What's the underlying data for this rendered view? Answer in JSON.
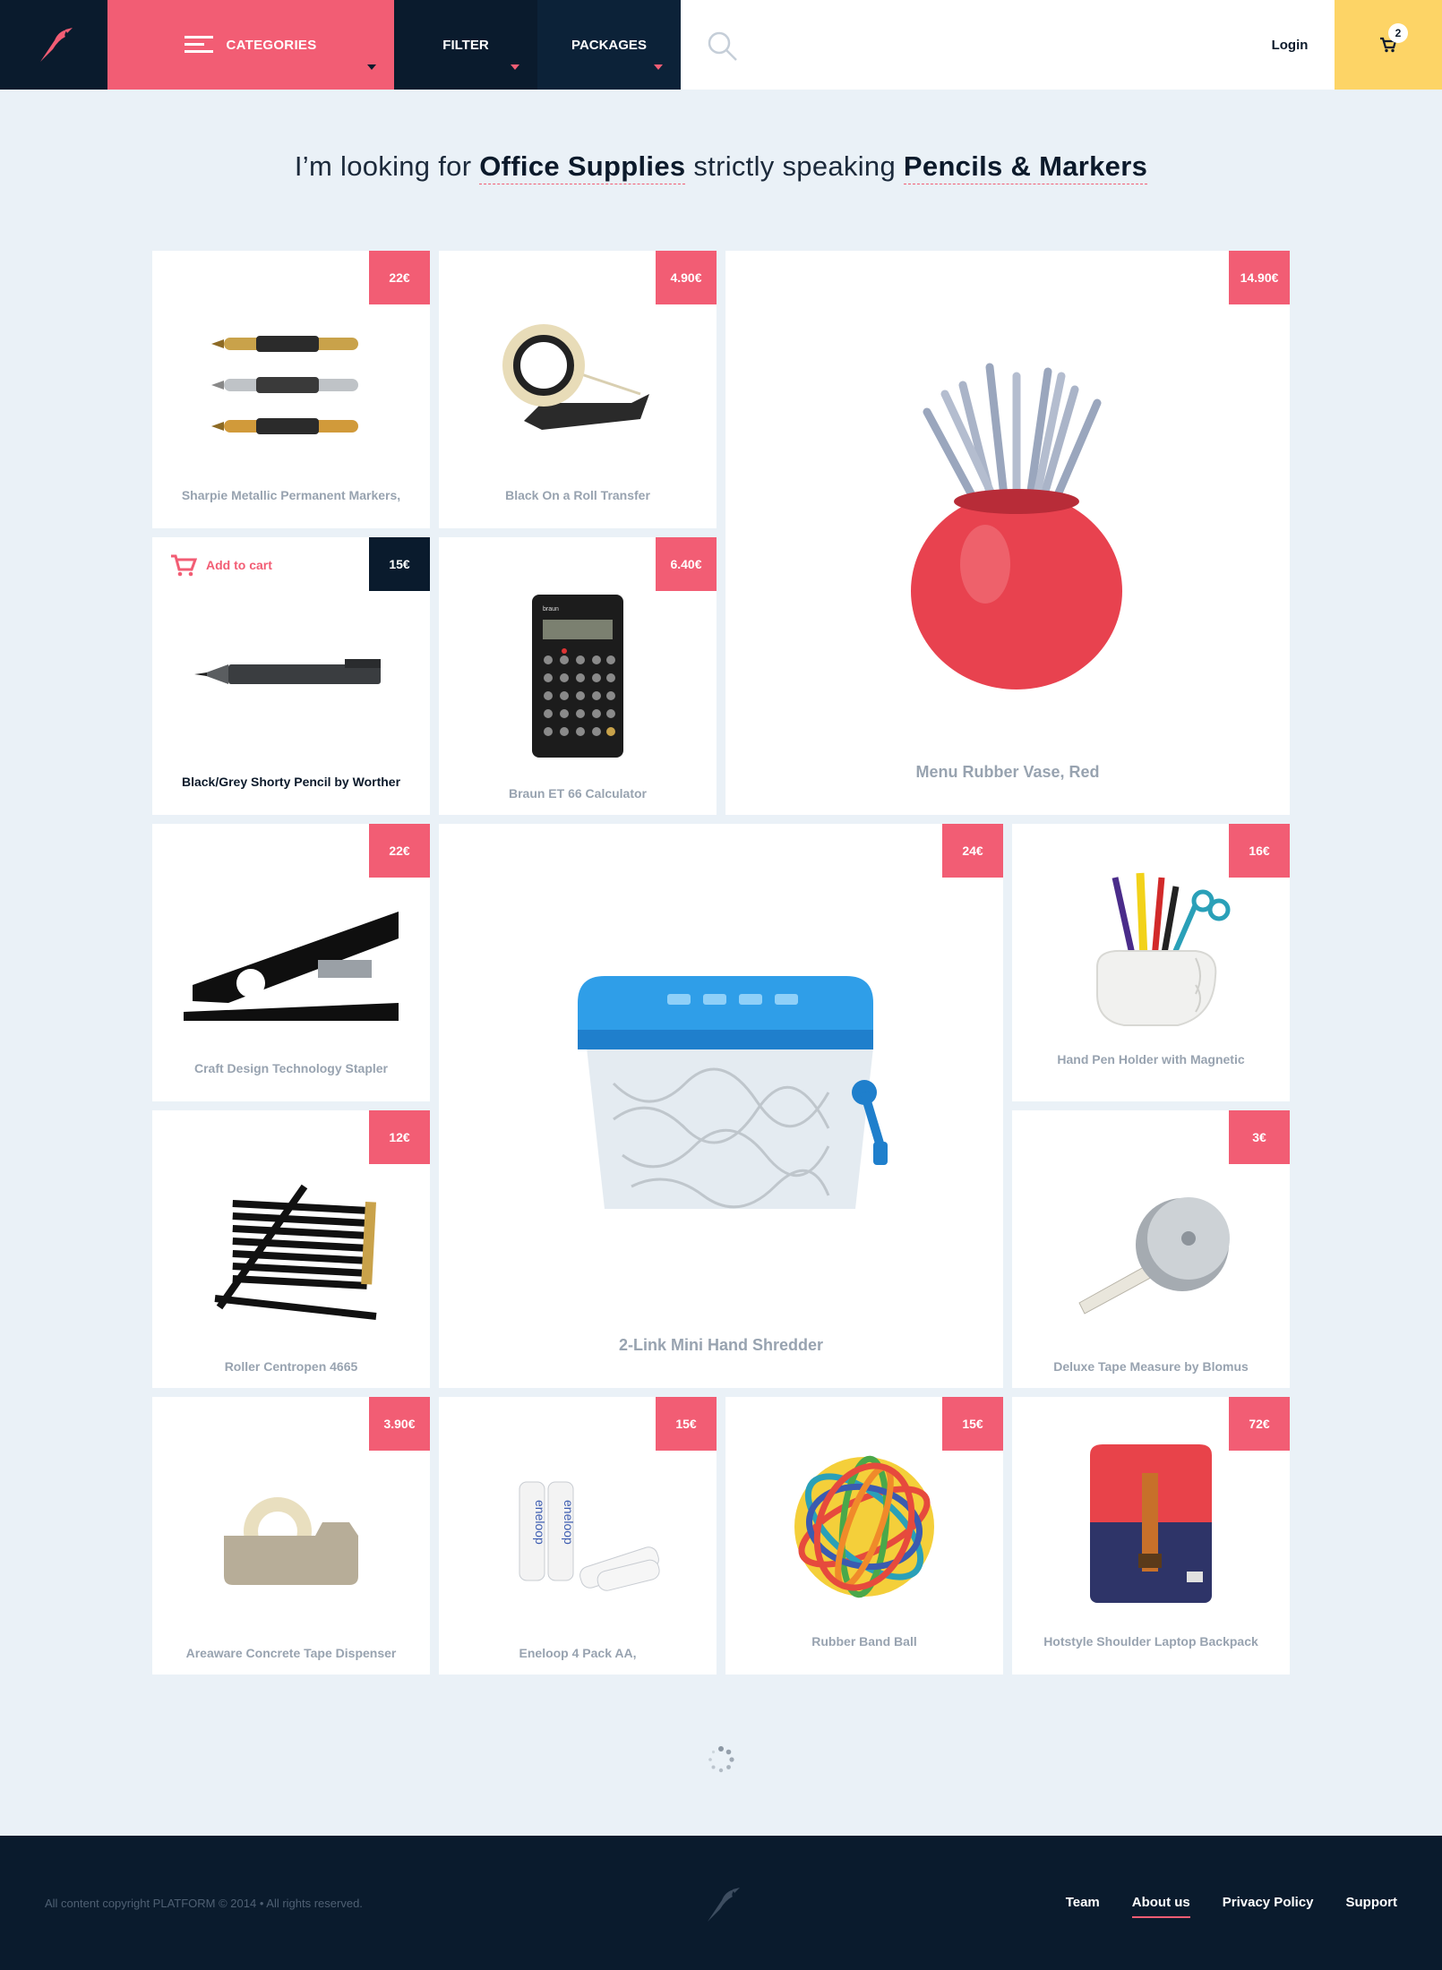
{
  "header": {
    "categories_label": "CATEGORIES",
    "filter_label": "FILTER",
    "packages_label": "PACKAGES",
    "login_label": "Login",
    "cart_count": "2"
  },
  "headline": {
    "prefix": "I’m looking for",
    "category": "Office Supplies",
    "middle": "strictly speaking",
    "subcategory": "Pencils & Markers"
  },
  "products": [
    {
      "name": "Sharpie Metallic Permanent Markers,",
      "price": "22€",
      "icon": "markers"
    },
    {
      "name": "Black On a Roll Transfer",
      "price": "4.90€",
      "icon": "tape-roll"
    },
    {
      "name": "Menu Rubber Vase, Red",
      "price": "14.90€",
      "icon": "pencil-vase"
    },
    {
      "name": "Black/Grey Shorty Pencil by Worther",
      "price": "15€",
      "icon": "pencil",
      "add_to_cart": "Add to cart"
    },
    {
      "name": "Braun ET 66 Calculator",
      "price": "6.40€",
      "icon": "calculator"
    },
    {
      "name": "Craft Design Technology Stapler",
      "price": "22€",
      "icon": "stapler"
    },
    {
      "name": "2-Link Mini Hand Shredder",
      "price": "24€",
      "icon": "shredder"
    },
    {
      "name": "Hand Pen Holder with Magnetic",
      "price": "16€",
      "icon": "hand-holder"
    },
    {
      "name": "Roller Centropen 4665",
      "price": "12€",
      "icon": "pencils"
    },
    {
      "name": "Deluxe Tape Measure by Blomus",
      "price": "3€",
      "icon": "tape-measure"
    },
    {
      "name": "Areaware Concrete Tape Dispenser",
      "price": "3.90€",
      "icon": "tape-dispenser"
    },
    {
      "name": "Eneloop 4 Pack AA,",
      "price": "15€",
      "icon": "batteries"
    },
    {
      "name": "Rubber Band Ball",
      "price": "15€",
      "icon": "rubber-band-ball"
    },
    {
      "name": "Hotstyle Shoulder Laptop Backpack",
      "price": "72€",
      "icon": "backpack"
    }
  ],
  "footer": {
    "copyright": "All content copyright PLATFORM © 2014 • All rights reserved.",
    "links": [
      "Team",
      "About us",
      "Privacy Policy",
      "Support"
    ]
  },
  "colors": {
    "accent": "#f25d74",
    "navy": "#0a1b2d",
    "cart": "#fdd466",
    "background": "#eaf1f7"
  }
}
